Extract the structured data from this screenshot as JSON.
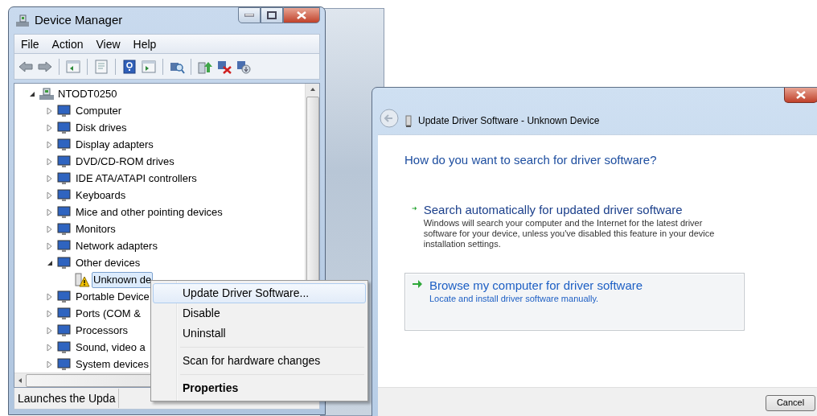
{
  "device_manager": {
    "title": "Device Manager",
    "menu": [
      "File",
      "Action",
      "View",
      "Help"
    ],
    "tree": [
      {
        "label": "NTODT0250",
        "expanded": true,
        "selected": false,
        "warning": false,
        "children": [
          {
            "label": "Computer",
            "expanded": false,
            "selected": false,
            "warning": false
          },
          {
            "label": "Disk drives",
            "expanded": false,
            "selected": false,
            "warning": false
          },
          {
            "label": "Display adapters",
            "expanded": false,
            "selected": false,
            "warning": false
          },
          {
            "label": "DVD/CD-ROM drives",
            "expanded": false,
            "selected": false,
            "warning": false
          },
          {
            "label": "IDE ATA/ATAPI controllers",
            "expanded": false,
            "selected": false,
            "warning": false
          },
          {
            "label": "Keyboards",
            "expanded": false,
            "selected": false,
            "warning": false
          },
          {
            "label": "Mice and other pointing devices",
            "expanded": false,
            "selected": false,
            "warning": false
          },
          {
            "label": "Monitors",
            "expanded": false,
            "selected": false,
            "warning": false
          },
          {
            "label": "Network adapters",
            "expanded": false,
            "selected": false,
            "warning": false
          },
          {
            "label": "Other devices",
            "expanded": true,
            "selected": false,
            "warning": false,
            "children": [
              {
                "label": "Unknown de",
                "selected": true,
                "warning": true
              }
            ]
          },
          {
            "label": "Portable Device",
            "expanded": false,
            "selected": false,
            "warning": false
          },
          {
            "label": "Ports (COM &",
            "expanded": false,
            "selected": false,
            "warning": false
          },
          {
            "label": "Processors",
            "expanded": false,
            "selected": false,
            "warning": false
          },
          {
            "label": "Sound, video a",
            "expanded": false,
            "selected": false,
            "warning": false
          },
          {
            "label": "System devices",
            "expanded": false,
            "selected": false,
            "warning": false
          }
        ]
      }
    ],
    "status_bar": "Launches the Upda"
  },
  "context_menu": {
    "groups": [
      {
        "items": [
          {
            "label": "Update Driver Software...",
            "selected": true,
            "bold": false
          },
          {
            "label": "Disable",
            "selected": false,
            "bold": false
          },
          {
            "label": "Uninstall",
            "selected": false,
            "bold": false
          }
        ]
      },
      {
        "items": [
          {
            "label": "Scan for hardware changes",
            "selected": false,
            "bold": false
          }
        ]
      },
      {
        "items": [
          {
            "label": "Properties",
            "selected": false,
            "bold": true
          }
        ]
      }
    ]
  },
  "dialog": {
    "title": "Update Driver Software - Unknown Device",
    "heading": "How do you want to search for driver software?",
    "options": [
      {
        "title": "Search automatically for updated driver software",
        "description": "Windows will search your computer and the Internet for the latest driver software for your device, unless you've disabled this feature in your device installation settings.",
        "selected": false
      },
      {
        "title": "Browse my computer for driver software",
        "description": "Locate and install driver software manually.",
        "selected": true
      }
    ],
    "buttons": [
      "Cancel"
    ]
  }
}
